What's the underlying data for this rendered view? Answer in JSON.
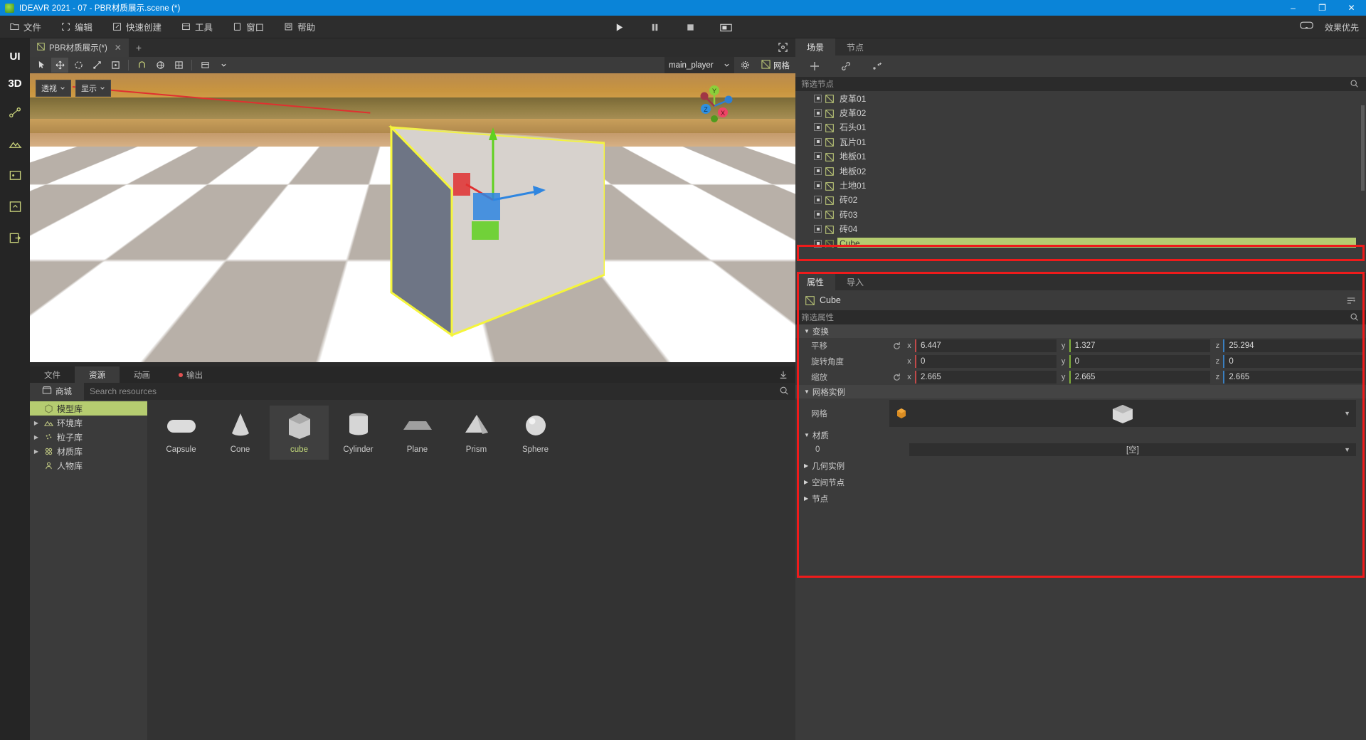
{
  "titlebar": {
    "title": "IDEAVR 2021 - 07 - PBR材质展示.scene (*)",
    "minimize": "–",
    "maximize": "❐",
    "close": "✕"
  },
  "menubar": {
    "items": [
      {
        "label": "文件",
        "icon": "folder-icon"
      },
      {
        "label": "编辑",
        "icon": "edit-icon"
      },
      {
        "label": "快速创建",
        "icon": "quick-create-icon"
      },
      {
        "label": "工具",
        "icon": "tools-icon"
      },
      {
        "label": "窗口",
        "icon": "window-icon"
      },
      {
        "label": "帮助",
        "icon": "help-icon"
      }
    ],
    "transport": [
      {
        "name": "play-button",
        "icon": "play-icon"
      },
      {
        "name": "pause-button",
        "icon": "pause-icon"
      },
      {
        "name": "stop-button",
        "icon": "stop-icon"
      },
      {
        "name": "screenshot-button",
        "icon": "camera-icon"
      }
    ],
    "right": {
      "vr_icon": "vr-headset-icon",
      "quality_label": "效果优先"
    }
  },
  "rail": {
    "modes": [
      {
        "label": "UI",
        "active": true
      },
      {
        "label": "3D",
        "active": true
      }
    ],
    "icons": [
      "node-graph-icon",
      "terrain-icon",
      "media-icon",
      "export-icon",
      "exit-icon"
    ]
  },
  "viewport": {
    "tab": {
      "label": "PBR材质展示(*)",
      "close": "✕",
      "add": "+"
    },
    "expand_icon": "expand-icon",
    "toolbar": {
      "tools": [
        {
          "name": "select-tool",
          "icon": "cursor-icon",
          "active": false
        },
        {
          "name": "move-tool",
          "icon": "move-icon",
          "active": true
        },
        {
          "name": "rotate-tool",
          "icon": "rotate-icon",
          "active": false
        },
        {
          "name": "scale-tool",
          "icon": "scale-icon",
          "active": false
        },
        {
          "name": "transform-tool",
          "icon": "transform-icon",
          "active": false
        },
        {
          "name": "magnet-tool",
          "icon": "magnet-icon",
          "active": false
        },
        {
          "name": "local-global-tool",
          "icon": "globe-icon",
          "active": false
        },
        {
          "name": "grid-snap-tool",
          "icon": "grid-snap-icon",
          "active": false
        },
        {
          "name": "layout-tool",
          "icon": "layout-icon",
          "active": false
        }
      ],
      "player": "main_player",
      "settings_icon": "gear-icon",
      "mesh_label": "网格",
      "mesh_icon": "mesh-icon"
    },
    "overlay": {
      "perspective": "透视",
      "display": "显示"
    },
    "gizmo": {
      "axes": [
        "Y",
        "Z",
        "X"
      ]
    }
  },
  "bottom_panel": {
    "tabs": [
      {
        "label": "文件",
        "active": false,
        "dot": false
      },
      {
        "label": "资源",
        "active": true,
        "dot": false
      },
      {
        "label": "动画",
        "active": false,
        "dot": false
      },
      {
        "label": "输出",
        "active": false,
        "dot": true
      }
    ],
    "collapse_icon": "collapse-icon",
    "shop": {
      "label": "商城",
      "icon": "shop-icon"
    },
    "search": {
      "placeholder": "Search resources",
      "value": "",
      "icon": "search-icon"
    },
    "library": [
      {
        "label": "模型库",
        "icon": "cube-icon",
        "selected": true,
        "expandable": false
      },
      {
        "label": "环境库",
        "icon": "mountain-icon",
        "selected": false,
        "expandable": true
      },
      {
        "label": "粒子库",
        "icon": "particles-icon",
        "selected": false,
        "expandable": true
      },
      {
        "label": "材质库",
        "icon": "material-icon",
        "selected": false,
        "expandable": true
      },
      {
        "label": "人物库",
        "icon": "person-icon",
        "selected": false,
        "expandable": false
      }
    ],
    "assets": [
      {
        "label": "Capsule",
        "shape": "capsule",
        "selected": false
      },
      {
        "label": "Cone",
        "shape": "cone",
        "selected": false
      },
      {
        "label": "cube",
        "shape": "cube",
        "selected": true
      },
      {
        "label": "Cylinder",
        "shape": "cylinder",
        "selected": false
      },
      {
        "label": "Plane",
        "shape": "plane",
        "selected": false
      },
      {
        "label": "Prism",
        "shape": "prism",
        "selected": false
      },
      {
        "label": "Sphere",
        "shape": "sphere",
        "selected": false
      }
    ]
  },
  "right_panel": {
    "tabs": [
      {
        "label": "场景",
        "active": true
      },
      {
        "label": "节点",
        "active": false
      }
    ],
    "toolbar": [
      {
        "name": "add-node-button",
        "icon": "plus-icon"
      },
      {
        "name": "link-node-button",
        "icon": "link-icon"
      },
      {
        "name": "node-tree-button",
        "icon": "node-add-icon"
      }
    ],
    "filter_nodes": {
      "placeholder": "筛选节点",
      "icon": "search-icon"
    },
    "tree": [
      {
        "label": "皮革01",
        "selected": false
      },
      {
        "label": "皮革02",
        "selected": false
      },
      {
        "label": "石头01",
        "selected": false
      },
      {
        "label": "瓦片01",
        "selected": false
      },
      {
        "label": "地板01",
        "selected": false
      },
      {
        "label": "地板02",
        "selected": false
      },
      {
        "label": "土地01",
        "selected": false
      },
      {
        "label": "砖02",
        "selected": false
      },
      {
        "label": "砖03",
        "selected": false
      },
      {
        "label": "砖04",
        "selected": false
      },
      {
        "label": "Cube",
        "selected": true
      }
    ],
    "properties": {
      "tabs": [
        {
          "label": "属性",
          "active": true
        },
        {
          "label": "导入",
          "active": false
        }
      ],
      "object_name": "Cube",
      "object_icon": "mesh-icon",
      "sort_icon": "sort-icon",
      "filter_props": {
        "placeholder": "筛选属性",
        "icon": "search-icon"
      },
      "sections": [
        {
          "title": "变换",
          "expanded": true,
          "rows": [
            {
              "label": "平移",
              "reset": true,
              "x": "6.447",
              "y": "1.327",
              "z": "25.294"
            },
            {
              "label": "旋转角度",
              "reset": false,
              "x": "0",
              "y": "0",
              "z": "0"
            },
            {
              "label": "缩放",
              "reset": true,
              "x": "2.665",
              "y": "2.665",
              "z": "2.665"
            }
          ]
        }
      ],
      "mesh_instance": {
        "title": "网格实例",
        "row_label": "网格",
        "cube_icon": "cube-icon",
        "preview": "cube-preview",
        "chevron": "▼"
      },
      "material": {
        "title": "材质",
        "index": "0",
        "value": "[空]",
        "chevron": "▼"
      },
      "collapsed_sections": [
        {
          "title": "几何实例"
        },
        {
          "title": "空间节点"
        },
        {
          "title": "节点"
        }
      ]
    }
  }
}
